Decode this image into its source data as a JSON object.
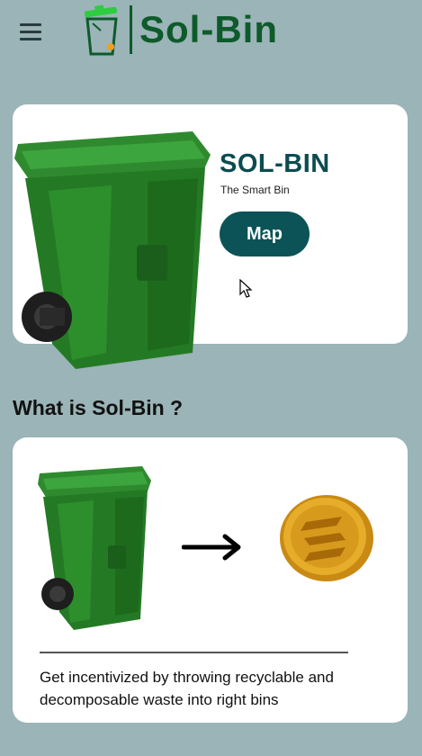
{
  "header": {
    "menu_icon": "hamburger-menu-icon",
    "logo_icon": "trash-bin-logo-icon",
    "logo_text": "Sol-Bin"
  },
  "hero": {
    "image_icon": "green-wheelie-bin-image",
    "title": "SOL-BIN",
    "subtitle": "The Smart Bin",
    "map_button": "Map"
  },
  "section": {
    "title": "What is Sol-Bin ?"
  },
  "info": {
    "bin_icon": "green-wheelie-bin-image",
    "arrow_icon": "right-arrow-icon",
    "coin_icon": "gold-sol-coin-image",
    "description": "Get incentivized by throwing recyclable and decomposable waste into right bins"
  },
  "colors": {
    "background": "#9ab4b7",
    "brand_green": "#0d5a2a",
    "title_teal": "#0c4c50",
    "button_teal": "#0b5356",
    "card": "#ffffff"
  }
}
